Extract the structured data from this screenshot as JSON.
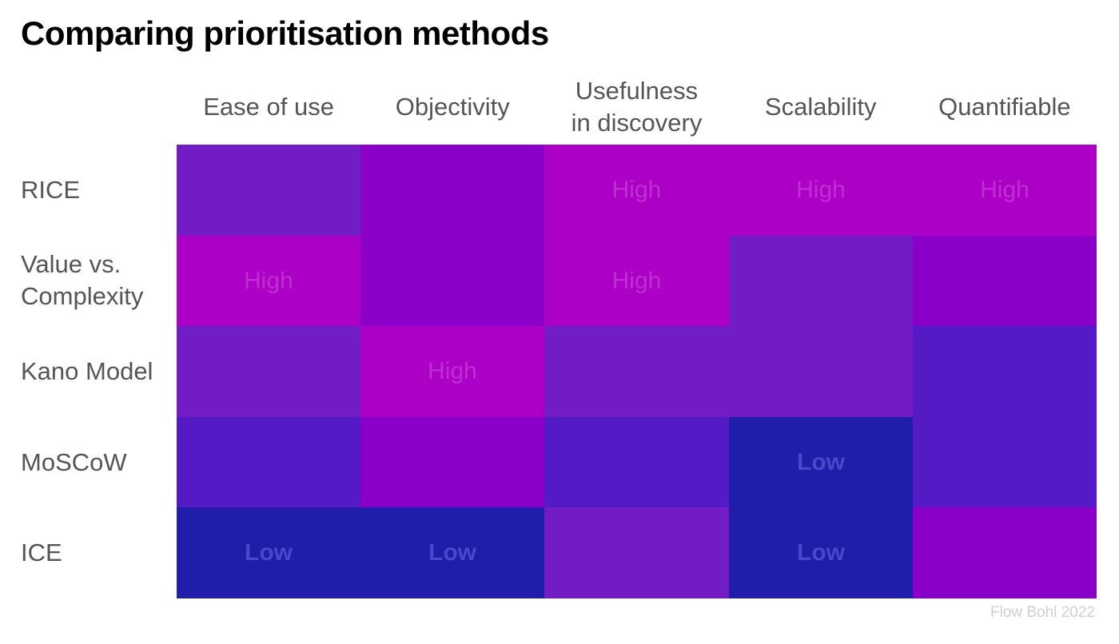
{
  "title": "Comparing prioritisation methods",
  "credit": "Flow Bohl 2022",
  "colors": {
    "1": "#1F1DAA",
    "2": "#531AC6",
    "3": "#721CC6",
    "4": "#8A00C8",
    "5": "#AD00C6",
    "label_low": "#4A47C8",
    "label_high": "#BE2FD2"
  },
  "chart_data": {
    "type": "heatmap",
    "title": "Comparing prioritisation methods",
    "columns": [
      "Ease of use",
      "Objectivity",
      "Usefulness\nin discovery",
      "Scalability",
      "Quantifiable"
    ],
    "rows": [
      "RICE",
      "Value vs.\nComplexity",
      "Kano Model",
      "MoSCoW",
      "ICE"
    ],
    "scale": {
      "min": 1,
      "max": 5,
      "min_label": "Low",
      "max_label": "High"
    },
    "values": [
      [
        3,
        4,
        5,
        5,
        5
      ],
      [
        5,
        4,
        5,
        3,
        4
      ],
      [
        3,
        5,
        3,
        3,
        2
      ],
      [
        2,
        4,
        2,
        1,
        2
      ],
      [
        1,
        1,
        3,
        1,
        4
      ]
    ],
    "labels": [
      [
        "",
        "",
        "High",
        "High",
        "High"
      ],
      [
        "High",
        "",
        "High",
        "",
        ""
      ],
      [
        "",
        "High",
        "",
        "",
        ""
      ],
      [
        "",
        "",
        "",
        "Low",
        ""
      ],
      [
        "Low",
        "Low",
        "",
        "Low",
        ""
      ]
    ],
    "legend": "none",
    "grid": false
  }
}
